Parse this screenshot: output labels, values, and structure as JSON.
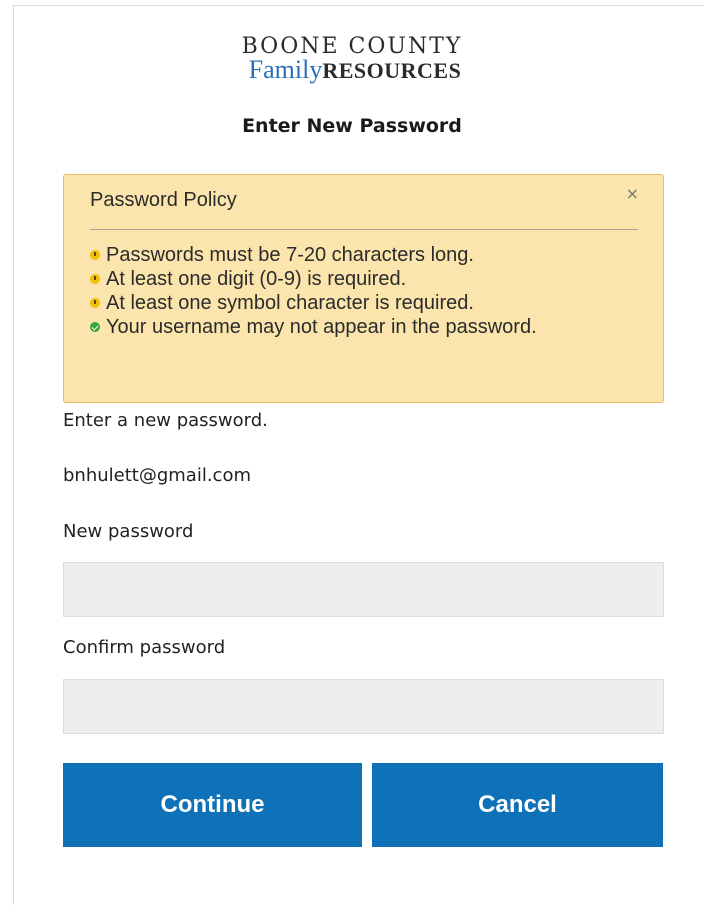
{
  "brand": {
    "line1": "BOONE COUNTY",
    "line2_family": "Family",
    "line2_resources": "RESOURCES"
  },
  "page": {
    "title": "Enter New Password",
    "instruction": "Enter a new password.",
    "username": "bnhulett@gmail.com"
  },
  "policy": {
    "title": "Password Policy",
    "close_label": "×",
    "rules": [
      {
        "text": "Passwords must be 7-20 characters long.",
        "status": "warn"
      },
      {
        "text": "At least one digit (0-9) is required.",
        "status": "warn"
      },
      {
        "text": "At least one symbol character is required.",
        "status": "warn"
      },
      {
        "text": "Your username may not appear in the password.",
        "status": "ok"
      }
    ],
    "colors": {
      "background": "#fbe5ad",
      "border": "#e7b86a",
      "warn": "#f0c000",
      "ok": "#3aa33a"
    }
  },
  "form": {
    "new_password_label": "New password",
    "new_password_value": "",
    "confirm_password_label": "Confirm password",
    "confirm_password_value": ""
  },
  "buttons": {
    "continue_label": "Continue",
    "cancel_label": "Cancel",
    "color": "#0f72b9"
  }
}
